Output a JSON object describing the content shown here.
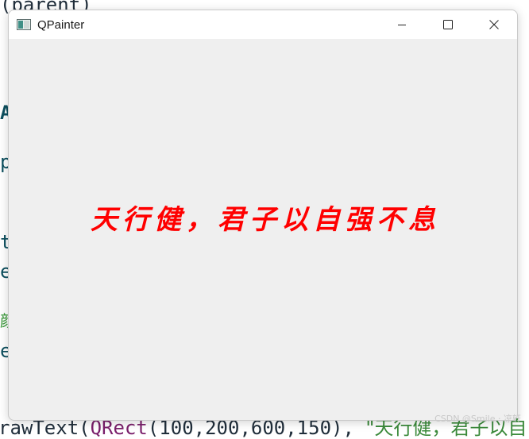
{
  "background_editor": {
    "line_top": "(parent)",
    "line_a": "A",
    "line_p": "p",
    "line_t": "t",
    "line_e1": "e",
    "line_cjk": "颜",
    "line_e2": "e",
    "bottom_fn": "rawText(",
    "bottom_cls": "QRect",
    "bottom_args": "(100,200,600,150),",
    "bottom_str": "\"天行健，君子以自"
  },
  "window": {
    "title": "QPainter",
    "controls": {
      "minimize": "minimize",
      "maximize": "maximize",
      "close": "close"
    }
  },
  "content": {
    "painted_text": "天行健，君子以自强不息",
    "text_color": "#ff0000",
    "background_color": "#efefef"
  },
  "watermark": "CSDN @Smile · 凉轩"
}
